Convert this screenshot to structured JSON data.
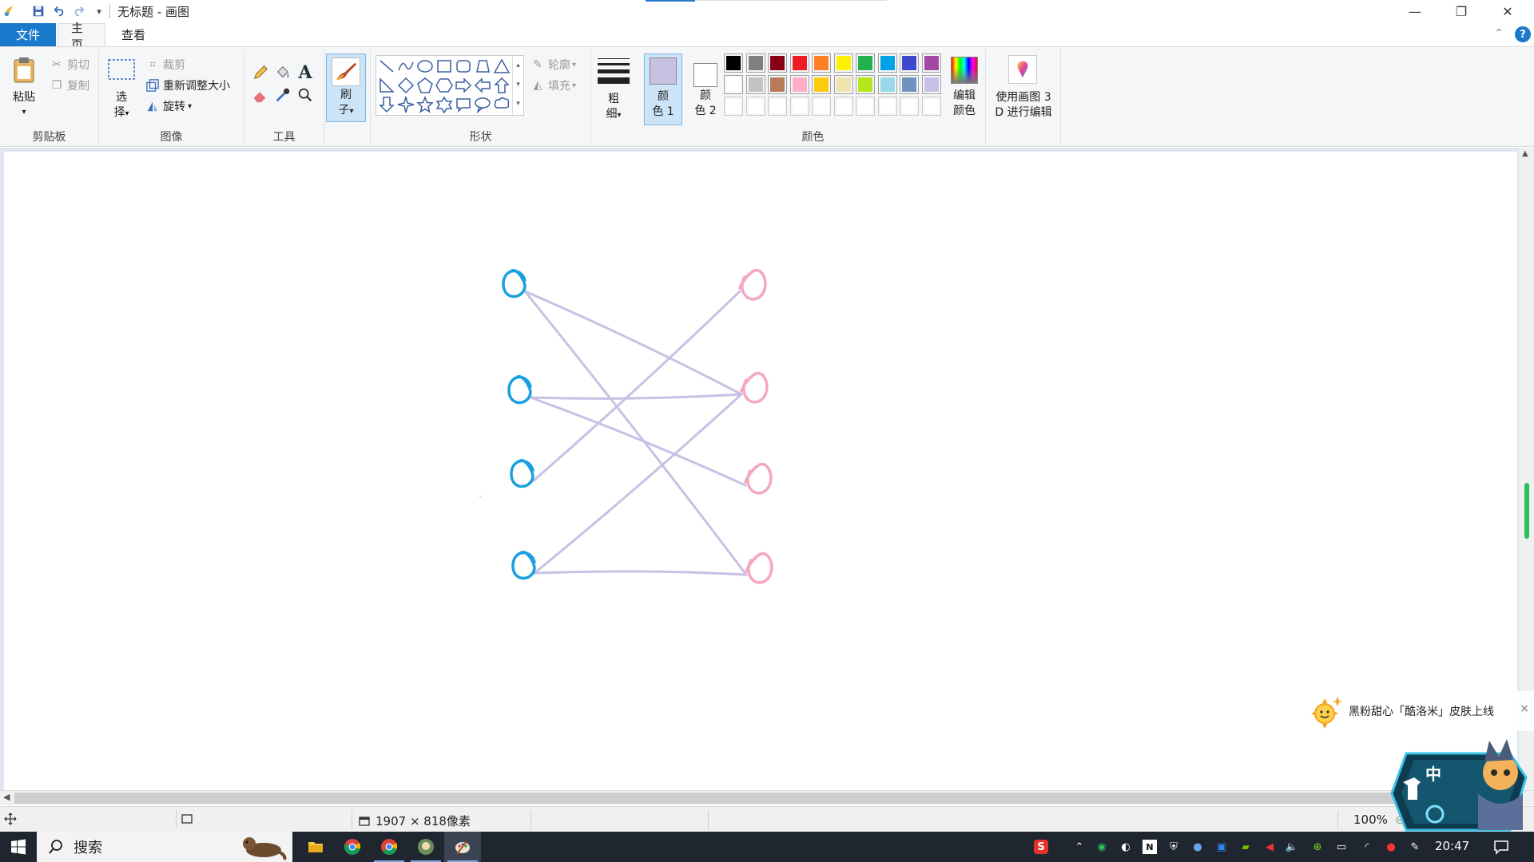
{
  "window": {
    "title": "无标题 - 画图",
    "minimize_glyph": "—",
    "maximize_glyph": "❐",
    "close_glyph": "✕"
  },
  "tabs": {
    "file": "文件",
    "home": "主页",
    "view": "查看",
    "collapse_glyph": "⌃",
    "help_glyph": "?"
  },
  "ribbon": {
    "clipboard": {
      "label": "剪贴板",
      "paste": "粘贴",
      "cut": "剪切",
      "copy": "复制"
    },
    "image": {
      "label": "图像",
      "select_l1": "选",
      "select_l2": "择",
      "crop": "裁剪",
      "resize": "重新调整大小",
      "rotate": "旋转"
    },
    "tools": {
      "label": "工具"
    },
    "brushes": {
      "l1": "刷",
      "l2": "子"
    },
    "shapes": {
      "label": "形状",
      "outline": "轮廓",
      "fill": "填充"
    },
    "size": {
      "l1": "粗",
      "l2": "细"
    },
    "color1": {
      "l1": "颜",
      "l2": "色 1",
      "value": "#c8c1e4"
    },
    "color2": {
      "l1": "颜",
      "l2": "色 2",
      "value": "#ffffff"
    },
    "colors": {
      "label": "颜色",
      "row1": [
        "#000000",
        "#7f7f7f",
        "#880015",
        "#ed1c24",
        "#ff7f27",
        "#fff200",
        "#22b14c",
        "#00a2e8",
        "#3f48cc",
        "#a349a4"
      ],
      "row2": [
        "#ffffff",
        "#c3c3c3",
        "#b97a57",
        "#ffaec9",
        "#ffc90e",
        "#efe4b0",
        "#b5e61d",
        "#99d9ea",
        "#7092be",
        "#c8bfe7"
      ],
      "row3": [
        "#ffffff",
        "#ffffff",
        "#ffffff",
        "#ffffff",
        "#ffffff",
        "#ffffff",
        "#ffffff",
        "#ffffff",
        "#ffffff",
        "#ffffff"
      ],
      "edit_l1": "编辑",
      "edit_l2": "颜色"
    },
    "paint3d": {
      "l1": "使用画图 3",
      "l2": "D 进行编辑"
    }
  },
  "canvas": {
    "stroke_colors": {
      "left_nodes": "#1aa0e0",
      "right_nodes": "#f4a6c4",
      "edges": "#c8c1e4"
    },
    "left_nodes": 4,
    "right_nodes": 4,
    "edges": [
      [
        1,
        2
      ],
      [
        1,
        4
      ],
      [
        2,
        2
      ],
      [
        2,
        3
      ],
      [
        3,
        1
      ],
      [
        4,
        2
      ],
      [
        4,
        4
      ]
    ]
  },
  "status": {
    "dimensions": "1907 × 818像素",
    "zoom": "100%"
  },
  "taskbar": {
    "search_placeholder": "搜索",
    "time": "20:47"
  },
  "popup": {
    "text": "黑粉甜心「酷洛米」皮肤上线",
    "close_glyph": "×"
  },
  "ime": {
    "char": "中"
  }
}
